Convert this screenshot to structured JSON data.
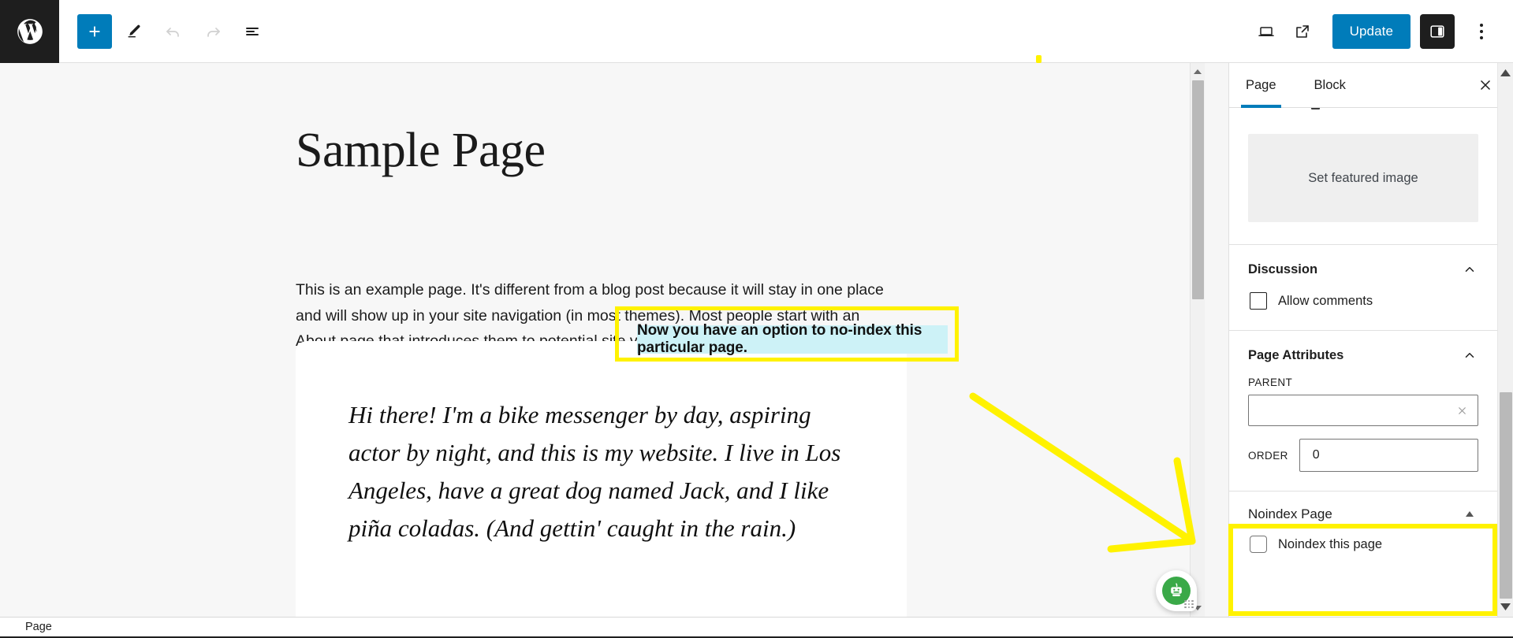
{
  "topbar": {
    "logo_icon": "wordpress-logo-icon",
    "add_block_label": "+",
    "add_block_icon": "plus-icon",
    "tools_icon": "pencil-edit-icon",
    "undo_icon": "undo-arrow-icon",
    "redo_icon": "redo-arrow-icon",
    "list_view_icon": "list-view-icon",
    "preview_icon": "desktop-preview-icon",
    "view_icon": "external-link-icon",
    "update_label": "Update",
    "settings_icon": "settings-sidebar-icon",
    "options_icon": "kebab-more-icon"
  },
  "editor": {
    "title": "Sample Page",
    "paragraph": "This is an example page. It's different from a blog post because it will stay in one place and will show up in your site navigation (in most themes). Most people start with an About page that introduces them to potential site visitors. It might say something like this:",
    "quote": "Hi there! I'm a bike messenger by day, aspiring actor by night, and this is my website. I live in Los Angeles, have a great dog named Jack, and I like piña coladas. (And gettin' caught in the rain.)"
  },
  "sidebar": {
    "tabs": [
      {
        "label": "Page",
        "active": true
      },
      {
        "label": "Block",
        "active": false
      }
    ],
    "close_icon": "close-x-icon",
    "featured_image": {
      "label": "Set featured image"
    },
    "discussion": {
      "title": "Discussion",
      "collapse_icon": "chevron-up-icon",
      "allow_comments_label": "Allow comments",
      "allow_comments_checked": false
    },
    "page_attributes": {
      "title": "Page Attributes",
      "collapse_icon": "chevron-up-icon",
      "parent_label": "PARENT",
      "parent_value": "",
      "parent_clear_icon": "clear-x-icon",
      "order_label": "ORDER",
      "order_value": "0"
    },
    "noindex": {
      "title": "Noindex Page",
      "collapse_icon": "triangle-up-icon",
      "checkbox_label": "Noindex this page",
      "checked": false
    },
    "scrollbar": {
      "up_icon": "scroll-up-arrow-icon",
      "down_icon": "scroll-down-arrow-icon"
    }
  },
  "canvas_scrollbar": {
    "up_icon": "scroll-up-arrow-icon",
    "down_icon": "scroll-down-arrow-icon"
  },
  "bottombar": {
    "breadcrumb": "Page"
  },
  "annotations": {
    "callout_text": "Now you have an option to no-index this particular page.",
    "highlight_color": "#fff200",
    "callout_bg": "#cdf2f7",
    "arrow_name": "yellow-pointer-arrow"
  },
  "chatbot": {
    "icon": "robot-assistant-icon"
  },
  "colors": {
    "accent": "#007cba",
    "dark": "#1e1e1e",
    "canvas": "#f7f7f7",
    "annotation_yellow": "#fff200"
  }
}
